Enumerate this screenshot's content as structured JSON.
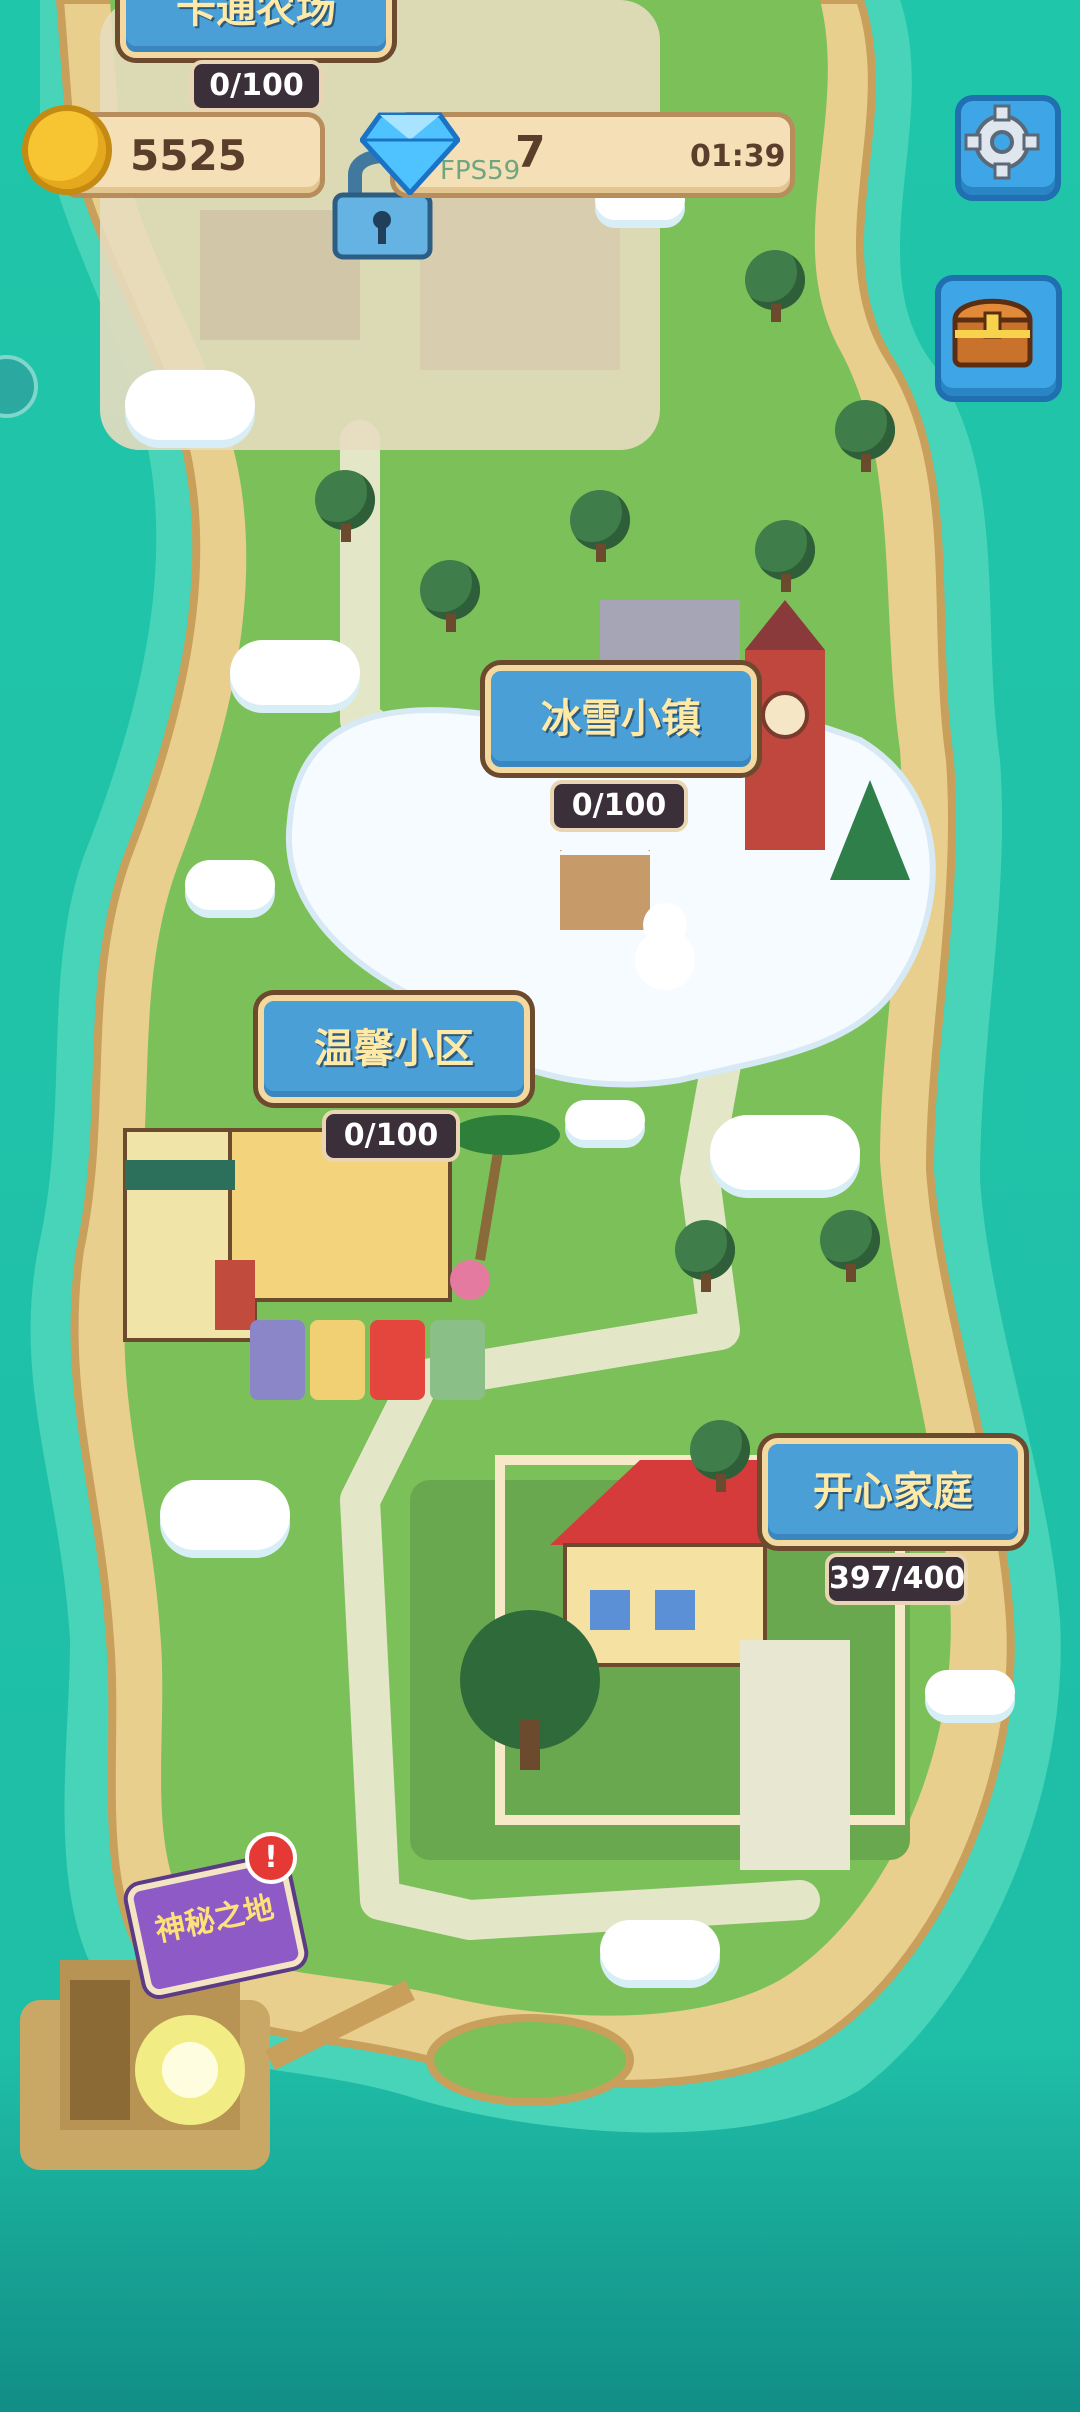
{
  "hud": {
    "coins": "5525",
    "gems": "7",
    "timer": "01:39",
    "fps": "FPS59"
  },
  "locations": {
    "cartoon_farm": {
      "title": "卡通农场",
      "progress": "0/100",
      "locked": true
    },
    "snow_town": {
      "title": "冰雪小镇",
      "progress": "0/100"
    },
    "cozy_community": {
      "title": "温馨小区",
      "progress": "0/100"
    },
    "happy_home": {
      "title": "开心家庭",
      "progress": "397/400"
    },
    "mystery_land": {
      "title": "神秘之地",
      "alert": "!"
    }
  },
  "icons": {
    "coin": "coin-icon",
    "gem": "gem-icon",
    "settings": "gear-icon",
    "chest": "treasure-chest-icon",
    "lock": "lock-icon"
  },
  "colors": {
    "sea": "#1fc3a8",
    "sand": "#e9cf8e",
    "grass": "#7cc05a",
    "label_blue": "#4a9fd6",
    "label_text": "#ffe9a6",
    "alert_red": "#e53935"
  }
}
